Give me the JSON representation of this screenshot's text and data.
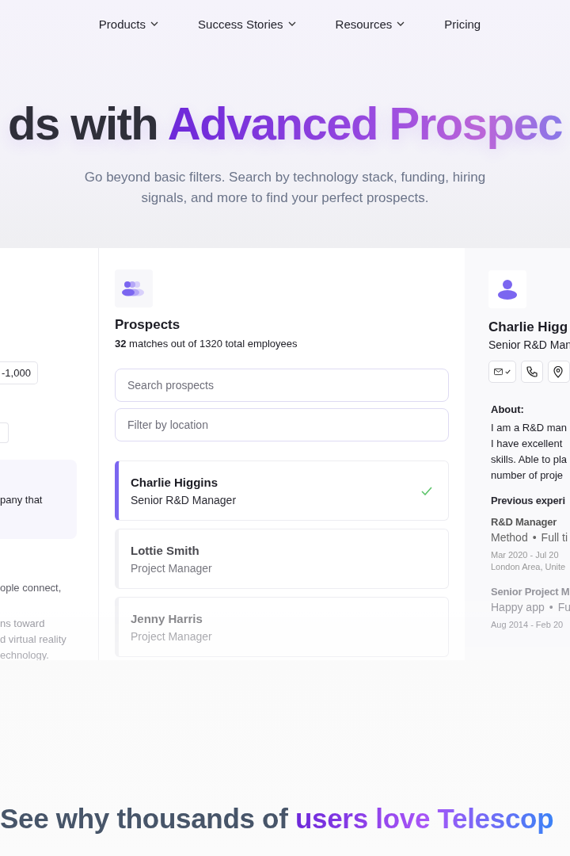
{
  "nav": {
    "items": [
      {
        "label": "Products",
        "dropdown": true
      },
      {
        "label": "Success Stories",
        "dropdown": true
      },
      {
        "label": "Resources",
        "dropdown": true
      },
      {
        "label": "Pricing",
        "dropdown": false
      }
    ]
  },
  "hero": {
    "heading": [
      {
        "text": "ds with ",
        "kind": "plain"
      },
      {
        "text": "Advanced Prospec",
        "kind": "accent"
      }
    ],
    "subtitle": "Go beyond basic filters. Search by technology stack, funding, hiring signals, and more to find your perfect prospects."
  },
  "filters_panel": {
    "range_value": "-1,000",
    "company_text": "pany that",
    "paragraphs": [
      "ople connect,",
      "ns toward\nd virtual reality\nechnology."
    ]
  },
  "prospects": {
    "title": "Prospects",
    "summary": "**32** matches out of 1320 total employees",
    "search": {
      "placeholder": "Search prospects"
    },
    "location": {
      "placeholder": "Filter by location"
    },
    "items": [
      {
        "name": "Charlie Higgins",
        "title": "Senior R&D Manager",
        "selected": true
      },
      {
        "name": "Lottie Smith",
        "title": "Project Manager",
        "selected": false
      },
      {
        "name": "Jenny Harris",
        "title": "Project Manager",
        "selected": false
      }
    ]
  },
  "profile": {
    "name": "Charlie Higg",
    "title": "Senior R&D Man",
    "email_verified": true,
    "about_label": "About:",
    "about": "I am a R&D man\nI have excellent\nskills. Able to pla\nnumber of proje",
    "experience_label": "Previous experi",
    "experiences": [
      {
        "role": "R&D Manager",
        "company": "Method",
        "separator": "•",
        "type": "Full ti",
        "dates": "Mar 2020 - Jul 20",
        "location": "London Area, Unite"
      },
      {
        "role": "Senior Project M",
        "company": "Happy app",
        "separator": "•",
        "type": "Fu",
        "dates": "Aug 2014 - Feb 20"
      }
    ]
  },
  "love": {
    "heading": [
      {
        "text": "See why thousands of ",
        "kind": "plain"
      },
      {
        "text": "users love Telescop",
        "kind": "accent"
      }
    ]
  }
}
